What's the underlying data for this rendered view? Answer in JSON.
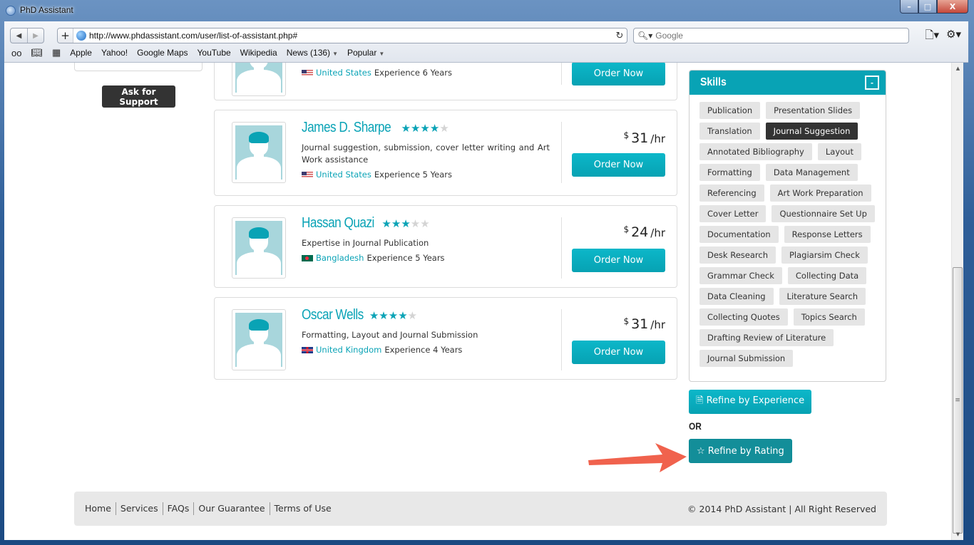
{
  "window": {
    "title": "PhD Assistant",
    "controls": {
      "minimize": "–",
      "maximize": "□",
      "close": "X"
    }
  },
  "toolbar": {
    "back_icon": "◀",
    "forward_icon": "▶",
    "add_icon": "+",
    "url": "http://www.phdassistant.com/user/list-of-assistant.php#",
    "reload_icon": "↻",
    "search_placeholder": "Google",
    "search_icon": "🔍︎▾",
    "page_menu_icon": "🗋▾",
    "settings_icon": "⚙▾"
  },
  "bookmarks": {
    "icons": {
      "reading_list": "oo",
      "bookmarks": "📖︎",
      "top_sites": "▦"
    },
    "items": [
      {
        "label": "Apple"
      },
      {
        "label": "Yahoo!"
      },
      {
        "label": "Google Maps"
      },
      {
        "label": "YouTube"
      },
      {
        "label": "Wikipedia"
      },
      {
        "label": "News (136)",
        "dropdown": true
      },
      {
        "label": "Popular",
        "dropdown": true
      }
    ]
  },
  "sidebar": {
    "support_button": "Ask for Support"
  },
  "assistants": [
    {
      "name": "",
      "rating": 0,
      "description": "",
      "country": "United States",
      "flag": "us",
      "experience": "Experience 6 Years",
      "rate": "",
      "order_label": "Order Now",
      "partial": true
    },
    {
      "name": "James D. Sharpe",
      "rating": 4,
      "description": "Journal suggestion, submission, cover letter writing and Art Work assistance",
      "country": "United States",
      "flag": "us",
      "experience": "Experience 5 Years",
      "currency": "$",
      "rate": "31",
      "per": "/hr",
      "order_label": "Order Now"
    },
    {
      "name": "Hassan Quazi",
      "rating": 3,
      "description": "Expertise in Journal Publication",
      "country": "Bangladesh",
      "flag": "bd",
      "experience": "Experience 5 Years",
      "currency": "$",
      "rate": "24",
      "per": "/hr",
      "order_label": "Order Now"
    },
    {
      "name": "Oscar Wells",
      "rating": 4,
      "description": "Formatting, Layout and Journal Submission",
      "country": "United Kingdom",
      "flag": "uk",
      "experience": "Experience 4 Years",
      "currency": "$",
      "rate": "31",
      "per": "/hr",
      "order_label": "Order Now"
    }
  ],
  "rating_max": 5,
  "skills": {
    "title": "Skills",
    "collapse_label": "-",
    "tags": [
      {
        "label": "Publication"
      },
      {
        "label": "Presentation Slides"
      },
      {
        "label": "Translation"
      },
      {
        "label": "Journal Suggestion",
        "active": true
      },
      {
        "label": "Annotated Bibliography"
      },
      {
        "label": "Layout"
      },
      {
        "label": "Formatting"
      },
      {
        "label": "Data Management"
      },
      {
        "label": "Referencing"
      },
      {
        "label": "Art Work Preparation"
      },
      {
        "label": "Cover Letter"
      },
      {
        "label": "Questionnaire Set Up"
      },
      {
        "label": "Documentation"
      },
      {
        "label": "Response Letters"
      },
      {
        "label": "Desk Research"
      },
      {
        "label": "Plagiarsim Check"
      },
      {
        "label": "Grammar Check"
      },
      {
        "label": "Collecting Data"
      },
      {
        "label": "Data Cleaning"
      },
      {
        "label": "Literature Search"
      },
      {
        "label": "Collecting Quotes"
      },
      {
        "label": "Topics Search"
      },
      {
        "label": "Drafting Review of Literature"
      },
      {
        "label": "Journal Submission"
      }
    ]
  },
  "refine": {
    "experience_icon": "🗎",
    "experience_label": "Refine by Experience",
    "or_label": "OR",
    "rating_icon": "☆",
    "rating_label": "Refine by Rating"
  },
  "footer": {
    "links": [
      "Home",
      "Services",
      "FAQs",
      "Our Guarantee",
      "Terms of Use"
    ],
    "copyright": "© 2014 PhD Assistant | All Right Reserved"
  },
  "colors": {
    "accent": "#0aa3b6",
    "active_tag": "#333333",
    "rating_button": "#138e99",
    "annotation_arrow": "#f0624d"
  }
}
